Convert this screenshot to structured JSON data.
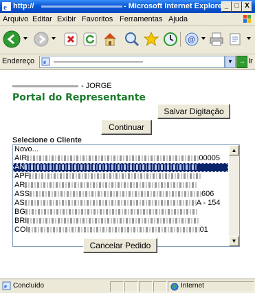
{
  "window": {
    "title_prefix": "http://",
    "title_suffix": "- Microsoft Internet Explorer",
    "min_label": "_",
    "max_label": "□",
    "close_label": "X"
  },
  "menu": {
    "items": [
      "Arquivo",
      "Editar",
      "Exibir",
      "Favoritos",
      "Ferramentas",
      "Ajuda"
    ]
  },
  "address": {
    "label": "Endereço",
    "go_label": "Ir"
  },
  "page": {
    "user_suffix": "- JORGE",
    "portal_title": "Portal do Representante",
    "save_button": "Salvar Digitação",
    "continue_button": "Continuar",
    "select_label": "Selecione o Cliente",
    "cancel_button": "Cancelar Pedido",
    "clients": [
      {
        "prefix": "Novo...",
        "suffix": "",
        "selected": false
      },
      {
        "prefix": "AIR",
        "suffix": "00005",
        "selected": false
      },
      {
        "prefix": "AN",
        "suffix": "",
        "selected": true
      },
      {
        "prefix": "APF",
        "suffix": "",
        "selected": false
      },
      {
        "prefix": "AR",
        "suffix": "",
        "selected": false
      },
      {
        "prefix": "ASS",
        "suffix": "606",
        "selected": false
      },
      {
        "prefix": "AS",
        "suffix": "A - 154",
        "selected": false
      },
      {
        "prefix": "BG",
        "suffix": "",
        "selected": false
      },
      {
        "prefix": "BRI",
        "suffix": "",
        "selected": false
      },
      {
        "prefix": "COI",
        "suffix": "01",
        "selected": false
      }
    ]
  },
  "status": {
    "text": "Concluído",
    "zone": "Internet"
  },
  "colors": {
    "title_bar": "#0a58d6",
    "portal_title": "#1a7a2a",
    "selection": "#0a246a"
  }
}
